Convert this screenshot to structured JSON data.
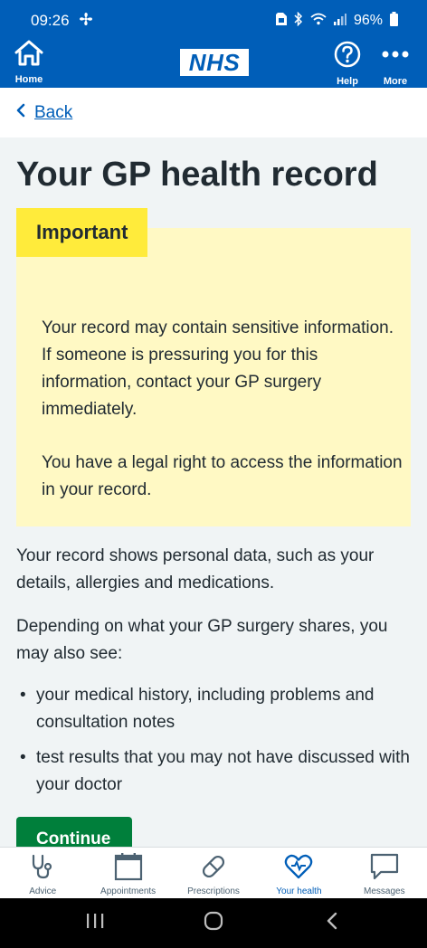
{
  "status": {
    "time": "09:26",
    "battery": "96%",
    "icons": [
      "fan-icon",
      "sim-icon",
      "bluetooth-icon",
      "wifi-icon",
      "signal-icon",
      "battery-icon"
    ]
  },
  "header": {
    "home_label": "Home",
    "logo_text": "NHS",
    "help_label": "Help",
    "more_label": "More"
  },
  "nav": {
    "back_label": "Back"
  },
  "page": {
    "title": "Your GP health record",
    "callout": {
      "label": "Important",
      "paragraphs": [
        "Your record may contain sensitive information. If someone is pressuring you for this information, contact your GP surgery immediately.",
        "You have a legal right to access the information in your record."
      ]
    },
    "intro": "Your record shows personal data, such as your details, allergies and medications.",
    "depending": "Depending on what your GP surgery shares, you may also see:",
    "bullets": [
      "your medical history, including problems and consultation notes",
      "test results that you may not have discussed with your doctor"
    ],
    "continue_label": "Continue"
  },
  "tabs": [
    {
      "label": "Advice",
      "icon": "stethoscope-icon"
    },
    {
      "label": "Appointments",
      "icon": "calendar-icon"
    },
    {
      "label": "Prescriptions",
      "icon": "pill-icon"
    },
    {
      "label": "Your health",
      "icon": "heart-icon",
      "active": true
    },
    {
      "label": "Messages",
      "icon": "message-icon"
    }
  ],
  "colors": {
    "nhs_blue": "#005eb8",
    "callout_bg": "#fff9c4",
    "callout_label_bg": "#ffeb3b",
    "continue_green": "#007f3b"
  }
}
